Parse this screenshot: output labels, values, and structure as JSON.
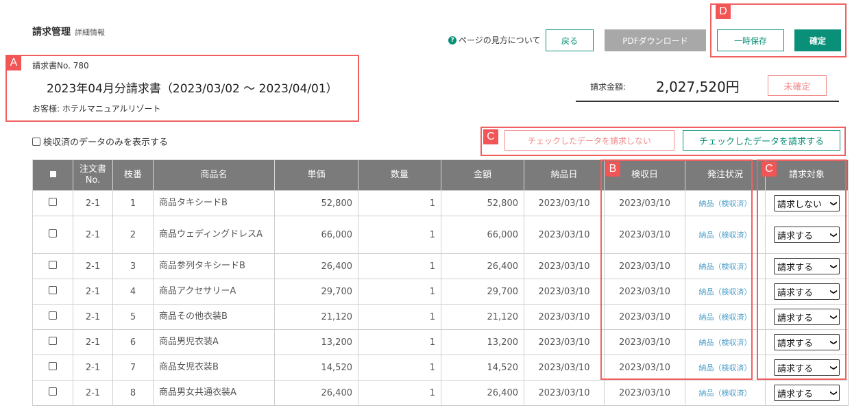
{
  "header": {
    "title": "請求管理",
    "subtitle": "詳細情報",
    "help_label": "ページの見方について",
    "help_icon": "help-circle-icon",
    "back_label": "戻る",
    "pdf_label": "PDFダウンロード",
    "save_label": "一時保存",
    "confirm_label": "確定"
  },
  "invoice": {
    "number": "請求書No. 780",
    "title": "2023年04月分請求書（2023/03/02 ～ 2023/04/01）",
    "customer": "お客様: ホテルマニュアルリゾート",
    "amount_label": "請求金額:",
    "amount_value": "2,027,520円",
    "status": "未確定"
  },
  "filter": {
    "label": "検収済のデータのみを表示する"
  },
  "actions": {
    "no_bill_label": "チェックしたデータを請求しない",
    "bill_label": "チェックしたデータを請求する"
  },
  "annotations": {
    "a": "A",
    "b": "B",
    "c1": "C",
    "c2": "C",
    "d": "D"
  },
  "table": {
    "columns": [
      "注文書\nNo.",
      "枝番",
      "商品名",
      "単価",
      "数量",
      "金額",
      "納品日",
      "検収日",
      "発注状況",
      "請求対象"
    ],
    "rows": [
      {
        "order": "2-1",
        "branch": "1",
        "name": "商品タキシードB",
        "price": "52,800",
        "qty": "1",
        "amount": "52,800",
        "delivered": "2023/03/10",
        "inspected": "2023/03/10",
        "status": "納品（検収済）",
        "target": "請求しない"
      },
      {
        "order": "2-1",
        "branch": "2",
        "name": "商品ウェディングドレスA",
        "price": "66,000",
        "qty": "1",
        "amount": "66,000",
        "delivered": "2023/03/10",
        "inspected": "2023/03/10",
        "status": "納品（検収済）",
        "target": "請求する"
      },
      {
        "order": "2-1",
        "branch": "3",
        "name": "商品参列タキシードB",
        "price": "26,400",
        "qty": "1",
        "amount": "26,400",
        "delivered": "2023/03/10",
        "inspected": "2023/03/10",
        "status": "納品（検収済）",
        "target": "請求する"
      },
      {
        "order": "2-1",
        "branch": "4",
        "name": "商品アクセサリーA",
        "price": "29,700",
        "qty": "1",
        "amount": "29,700",
        "delivered": "2023/03/10",
        "inspected": "2023/03/10",
        "status": "納品（検収済）",
        "target": "請求する"
      },
      {
        "order": "2-1",
        "branch": "5",
        "name": "商品その他衣装B",
        "price": "21,120",
        "qty": "1",
        "amount": "21,120",
        "delivered": "2023/03/10",
        "inspected": "2023/03/10",
        "status": "納品（検収済）",
        "target": "請求する"
      },
      {
        "order": "2-1",
        "branch": "6",
        "name": "商品男児衣装A",
        "price": "13,200",
        "qty": "1",
        "amount": "13,200",
        "delivered": "2023/03/10",
        "inspected": "2023/03/10",
        "status": "納品（検収済）",
        "target": "請求する"
      },
      {
        "order": "2-1",
        "branch": "7",
        "name": "商品女児衣装B",
        "price": "14,520",
        "qty": "1",
        "amount": "14,520",
        "delivered": "2023/03/10",
        "inspected": "2023/03/10",
        "status": "納品（検収済）",
        "target": "請求する"
      },
      {
        "order": "2-1",
        "branch": "8",
        "name": "商品男女共通衣装A",
        "price": "26,400",
        "qty": "1",
        "amount": "26,400",
        "delivered": "2023/03/10",
        "inspected": "2023/03/10",
        "status": "納品（検収済）",
        "target": "請求する"
      }
    ]
  },
  "colors": {
    "accent": "#0a8f78",
    "annotation": "#f06060",
    "header_bg": "#7b7b7b",
    "status_link": "#4a9ec9"
  }
}
